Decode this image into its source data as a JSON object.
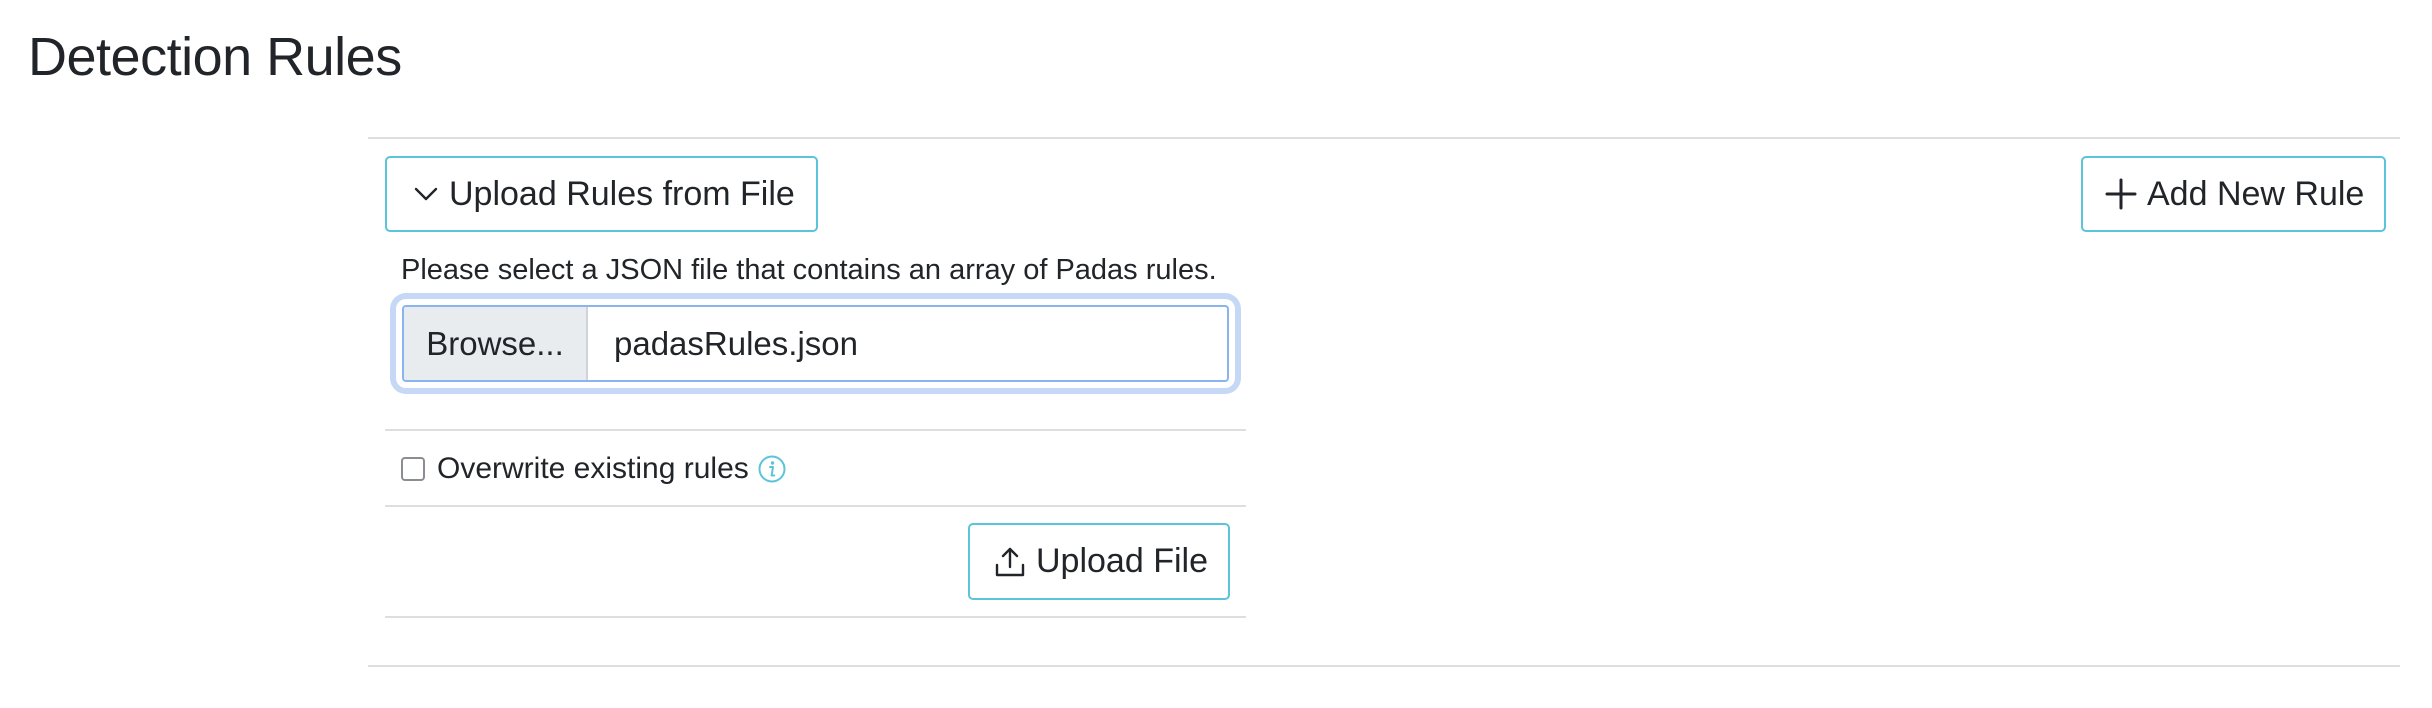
{
  "page": {
    "title": "Detection Rules"
  },
  "toolbar": {
    "upload_toggle_label": "Upload Rules from File",
    "upload_toggle_icon": "chevron-down-icon",
    "add_rule_label": "Add New Rule",
    "add_rule_icon": "plus-icon"
  },
  "upload_panel": {
    "help_text": "Please select a JSON file that contains an array of Padas rules.",
    "browse_label": "Browse...",
    "file_name": "padasRules.json",
    "overwrite_label": "Overwrite existing rules",
    "overwrite_checked": false,
    "info_icon": "info-icon",
    "upload_button_label": "Upload File",
    "upload_button_icon": "upload-icon"
  },
  "colors": {
    "accent_outline": "#5bc4d9",
    "focus_ring": "#c5d9f7",
    "focus_border": "#8ab4f0",
    "divider": "#dcdee0",
    "text": "#212529"
  }
}
